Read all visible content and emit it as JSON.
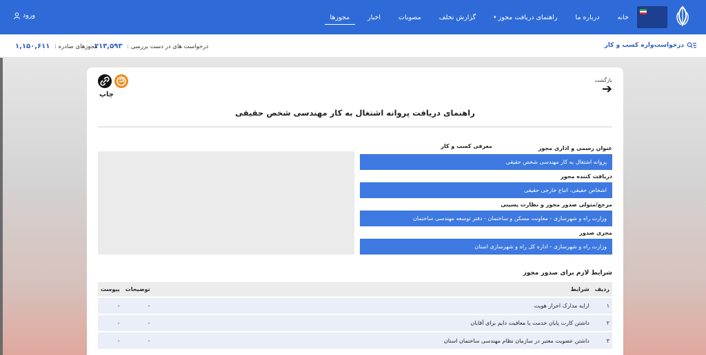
{
  "navbar": {
    "items": [
      {
        "label": "خانه"
      },
      {
        "label": "درباره ما"
      },
      {
        "label": "راهنمای دریافت مجوز",
        "has_caret": true
      },
      {
        "label": "گزارش تخلف"
      },
      {
        "label": "مصوبات"
      },
      {
        "label": "اخبار"
      },
      {
        "label": "مجوزها",
        "active": true
      }
    ],
    "login_label": "ورود"
  },
  "stats": {
    "business_request_label": "درخواست‌واره کسب و کار",
    "pending_label": "درخواست های در دست بررسی :",
    "pending_value": "۲۱۳,۵۹۳",
    "issued_label": "مجوزهای صادره :",
    "issued_value": "۱,۱۵۰,۶۱۱"
  },
  "card": {
    "back_label": "بازگشت",
    "print_label": "چاپ",
    "title": "راهنمای دریافت پروانه اشتغال به کار مهندسی شخص حقیقی",
    "fields": [
      {
        "label": "عنوان رسمی و اداری مجوز",
        "value": "پروانه اشتغال به کار مهندسی شخص حقیقی"
      },
      {
        "label": "دریافت کننده مجوز",
        "value": "اشخاص حقیقی، اتباع خارجی حقیقی"
      },
      {
        "label": "مرجع/متولی صدور مجوز و نظارت پسینی",
        "value": "وزارت راه و شهرسازی - معاونت مسکن و ساختمان - دفتر توسعه مهندسی ساختمان"
      },
      {
        "label": "مجری صدور",
        "value": "وزارت راه و شهرسازی - اداره کل راه و شهرسازی استان"
      }
    ],
    "intro_label": "معرفی کسب و کار",
    "requirements": {
      "title": "شرایط لازم برای صدور مجوز",
      "headers": {
        "num": "ردیف",
        "condition": "شرایط",
        "description": "توضیحات",
        "attachment": "پیوست"
      },
      "rows": [
        {
          "num": "۱",
          "condition": "ارایه مدارک احراز هویت",
          "description": "-",
          "attachment": "-"
        },
        {
          "num": "۲",
          "condition": "داشتن کارت پایان خدمت یا معافیت دایم برای آقایان",
          "description": "-",
          "attachment": "-"
        },
        {
          "num": "۳",
          "condition": "داشتن عضویت معتبر در سازمان نظام مهندسی ساختمان استان",
          "description": "-",
          "attachment": "-"
        }
      ]
    }
  },
  "colors": {
    "navbar": "#2f6bd8",
    "field_bg": "#3d79e0",
    "accent_text": "#2f5cbf",
    "share_icon": "#f08a1d"
  }
}
